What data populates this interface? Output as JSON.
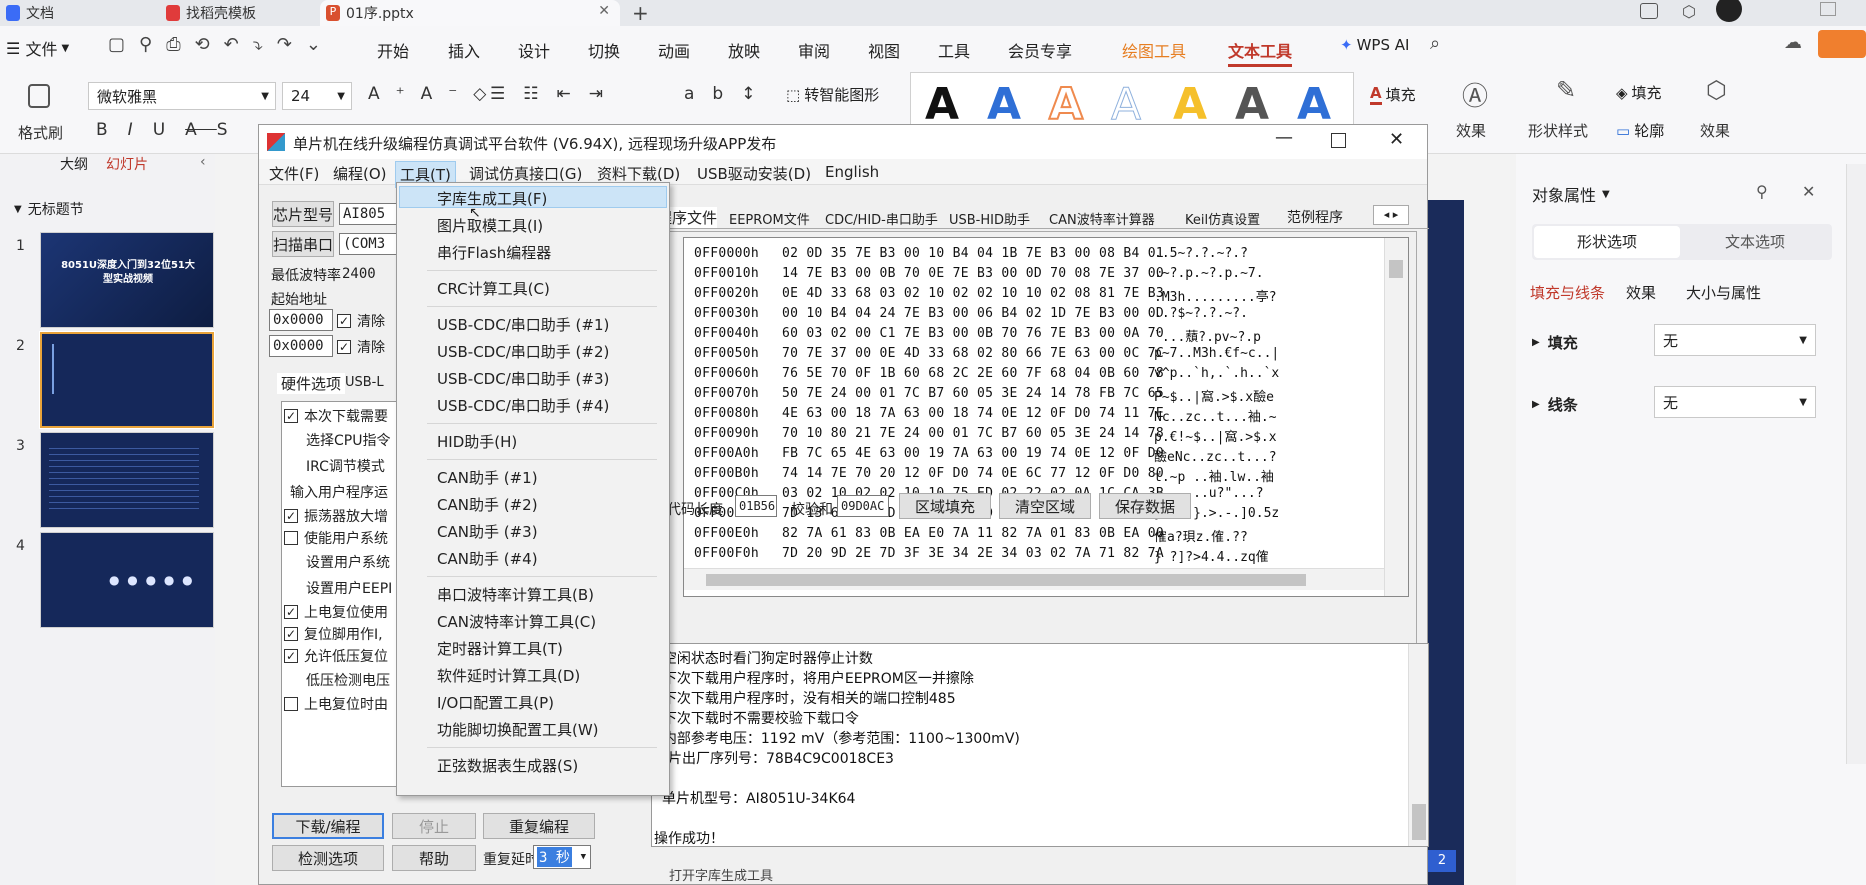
{
  "browser_tabs": [
    "文档",
    "找稻壳模板",
    "01序.pptx"
  ],
  "ribbon": {
    "file_menu": "文件",
    "menu_items": [
      "开始",
      "插入",
      "设计",
      "切换",
      "动画",
      "放映",
      "审阅",
      "视图",
      "工具",
      "会员专享",
      "绘图工具",
      "文本工具"
    ],
    "wps_ai": "WPS AI",
    "format_painter": "格式刷",
    "font_name": "微软雅黑",
    "font_size": "24",
    "smart_shape": "转智能图形",
    "fill": "填充",
    "effect": "效果",
    "shape_style": "形状样式",
    "outline": "轮廓",
    "fill2": "填充",
    "effect2": "效果",
    "colors": {
      "active_tab": "#c0392b",
      "drawing_tool": "#e67e22",
      "ai_brand": "#3b6cf6"
    }
  },
  "slide_pane": {
    "tabs": [
      "大纲",
      "幻灯片"
    ],
    "section": "无标题节",
    "slides": [
      {
        "num": "1",
        "text": "8051U深度入门到32位51大型实战视频"
      },
      {
        "num": "2",
        "text": ""
      },
      {
        "num": "3",
        "text": ""
      },
      {
        "num": "4",
        "text": ""
      }
    ]
  },
  "props_pane": {
    "title": "对象属性",
    "tabs": [
      "形状选项",
      "文本选项"
    ],
    "subtabs": [
      "填充与线条",
      "效果",
      "大小与属性"
    ],
    "fill_label": "填充",
    "fill_value": "无",
    "line_label": "线条",
    "line_value": "无"
  },
  "page_badge": "2",
  "app": {
    "title": "单片机在线升级编程仿真调试平台软件 (V6.94X), 远程现场升级APP发布",
    "menu": [
      "文件(F)",
      "编程(O)",
      "工具(T)",
      "调试仿真接口(G)",
      "资料下载(D)",
      "USB驱动安装(D)",
      "English"
    ],
    "chip_model_btn": "芯片型号",
    "chip_model_val": "AI805",
    "scan_port_btn": "扫描串口",
    "port_val": "(COM3",
    "min_baud_label": "最低波特率",
    "min_baud_val": "2400",
    "start_addr_label": "起始地址",
    "addr1": "0x0000",
    "addr2": "0x0000",
    "clear1": "清除",
    "clear2": "清除",
    "hw_tab": "硬件选项",
    "usb_tab": "USB-L",
    "options": [
      {
        "text": "本次下载需要",
        "checked": true
      },
      {
        "text": "选择CPU指令",
        "checked": null
      },
      {
        "text": "IRC调节模式",
        "checked": null
      },
      {
        "text": "输入用户程序运",
        "checked": null
      },
      {
        "text": "振荡器放大增",
        "checked": true
      },
      {
        "text": "使能用户系统",
        "checked": false
      },
      {
        "text": "设置用户系统",
        "checked": null
      },
      {
        "text": "设置用户EEPI",
        "checked": null
      },
      {
        "text": "上电复位使用",
        "checked": true
      },
      {
        "text": "复位脚用作I,",
        "checked": true
      },
      {
        "text": "允许低压复位",
        "checked": true
      },
      {
        "text": "低压检测电压",
        "checked": null
      },
      {
        "text": "上电复位时由",
        "checked": false
      }
    ],
    "right_tabs": [
      "程序文件",
      "EEPROM文件",
      "CDC/HID-串口助手",
      "USB-HID助手",
      "CAN波特率计算器",
      "Keil仿真设置",
      "范例程序"
    ],
    "hex_lines": [
      {
        "addr": "0FF0000h",
        "bytes": "02 0D 35 7E B3 00 10 B4 04 1B 7E B3 00 08 B4 01",
        "ascii": "..5~?.?.~?.?"
      },
      {
        "addr": "0FF0010h",
        "bytes": "14 7E B3 00 0B 70 0E 7E B3 00 0D 70 08 7E 37 00",
        "ascii": ".~?.p.~?.p.~7."
      },
      {
        "addr": "0FF0020h",
        "bytes": "0E 4D 33 68 03 02 10 02 02 10 10 02 08 81 7E B3",
        "ascii": ".M3h.........亭?"
      },
      {
        "addr": "0FF0030h",
        "bytes": "00 10 B4 04 24 7E B3 00 06 B4 02 1D 7E B3 00 0D",
        "ascii": "..?$~?.?.~?."
      },
      {
        "addr": "0FF0040h",
        "bytes": "60 03 02 00 C1 7E B3 00 0B 70 76 7E B3 00 0A 70",
        "ascii": "`...蘈?.pv~?.p"
      },
      {
        "addr": "0FF0050h",
        "bytes": "70 7E 37 00 0E 4D 33 68 02 80 66 7E 63 00 0C 7C",
        "ascii": "p~7..M3h.€f~c..|"
      },
      {
        "addr": "0FF0060h",
        "bytes": "76 5E 70 0F 1B 60 68 2C 2E 60 7F 68 04 0B 60 78",
        "ascii": "v^p..`h,.`.h..`x"
      },
      {
        "addr": "0FF0070h",
        "bytes": "50 7E 24 00 01 7C B7 60 05 3E 24 14 78 FB 7C 65",
        "ascii": "P~$..|窩.>$.x醶e"
      },
      {
        "addr": "0FF0080h",
        "bytes": "4E 63 00 18 7A 63 00 18 74 0E 12 0F D0 74 11 7E",
        "ascii": "Nc..zc..t...袖.~"
      },
      {
        "addr": "0FF0090h",
        "bytes": "70 10 80 21 7E 24 00 01 7C B7 60 05 3E 24 14 78",
        "ascii": "p.€!~$..|窩.>$.x"
      },
      {
        "addr": "0FF00A0h",
        "bytes": "FB 7C 65 4E 63 00 19 7A 63 00 19 74 0E 12 0F D0",
        "ascii": "醶eNc..zc..t...?"
      },
      {
        "addr": "0FF00B0h",
        "bytes": "74 14 7E 70 20 12 0F D0 74 0E 6C 77 12 0F D0 80",
        "ascii": "t.~p ..袖.lw..袖"
      },
      {
        "addr": "0FF00C0h",
        "bytes": "03 02 10 02 02 10 10 75 ED 02 22 02 0A 1C CA 3B",
        "ascii": ".......u?\"...?"
      },
      {
        "addr": "0FF00D0h",
        "bytes": "7D 13 6D FF 7D 0F 3E 04 2D 01 7D 30 0B 35 7A 71",
        "ascii": "}.m  }.>.-.]0.5z"
      },
      {
        "addr": "0FF00E0h",
        "bytes": "82 7A 61 83 0B EA E0 7A 11 82 7A 01 83 0B EA 00",
        "ascii": "傕a?珼z.傕.??"
      },
      {
        "addr": "0FF00F0h",
        "bytes": "7D 20 9D 2E 7D 3F 3E 34 2E 34 03 02 7A 71 82 7A",
        "ascii": "} ?]?>4.4..zq傕"
      }
    ],
    "code_len_label": "代码长度",
    "code_len_val": "01B56",
    "checksum_label": "校验和",
    "checksum_val": "09D0AC",
    "fill_area_btn": "区域填充",
    "clear_area_btn": "清空区域",
    "save_data_btn": "保存数据",
    "log_lines": [
      "  空闲状态时看门狗定时器停止计数",
      "  下次下载用户程序时，将用户EEPROM区一并擦除",
      "  下次下载用户程序时，没有相关的端口控制485",
      "  下次下载时不需要校验下载口令",
      "  内部参考电压：1192 mV（参考范围：1100~1300mV)",
      "芯片出厂序列号：78B4C9C0018CE3",
      "",
      "单片机型号：AI8051U-34K64",
      "",
      "操作成功！"
    ],
    "download_btn": "下载/编程",
    "stop_btn": "停止",
    "reprogram_btn": "重复编程",
    "check_btn": "检测选项",
    "help_btn": "帮助",
    "repeat_delay_label": "重复延时",
    "repeat_delay_val": "3 秒",
    "status_bottom": "打开字库生成工具"
  },
  "tools_menu": {
    "items": [
      "字库生成工具(F)",
      "图片取模工具(I)",
      "串行Flash编程器",
      "CRC计算工具(C)",
      "USB-CDC/串口助手 (#1)",
      "USB-CDC/串口助手 (#2)",
      "USB-CDC/串口助手 (#3)",
      "USB-CDC/串口助手 (#4)",
      "HID助手(H)",
      "CAN助手 (#1)",
      "CAN助手 (#2)",
      "CAN助手 (#3)",
      "CAN助手 (#4)",
      "串口波特率计算工具(B)",
      "CAN波特率计算工具(C)",
      "定时器计算工具(T)",
      "软件延时计算工具(D)",
      "I/O口配置工具(P)",
      "功能脚切换配置工具(W)",
      "正弦数据表生成器(S)"
    ]
  }
}
